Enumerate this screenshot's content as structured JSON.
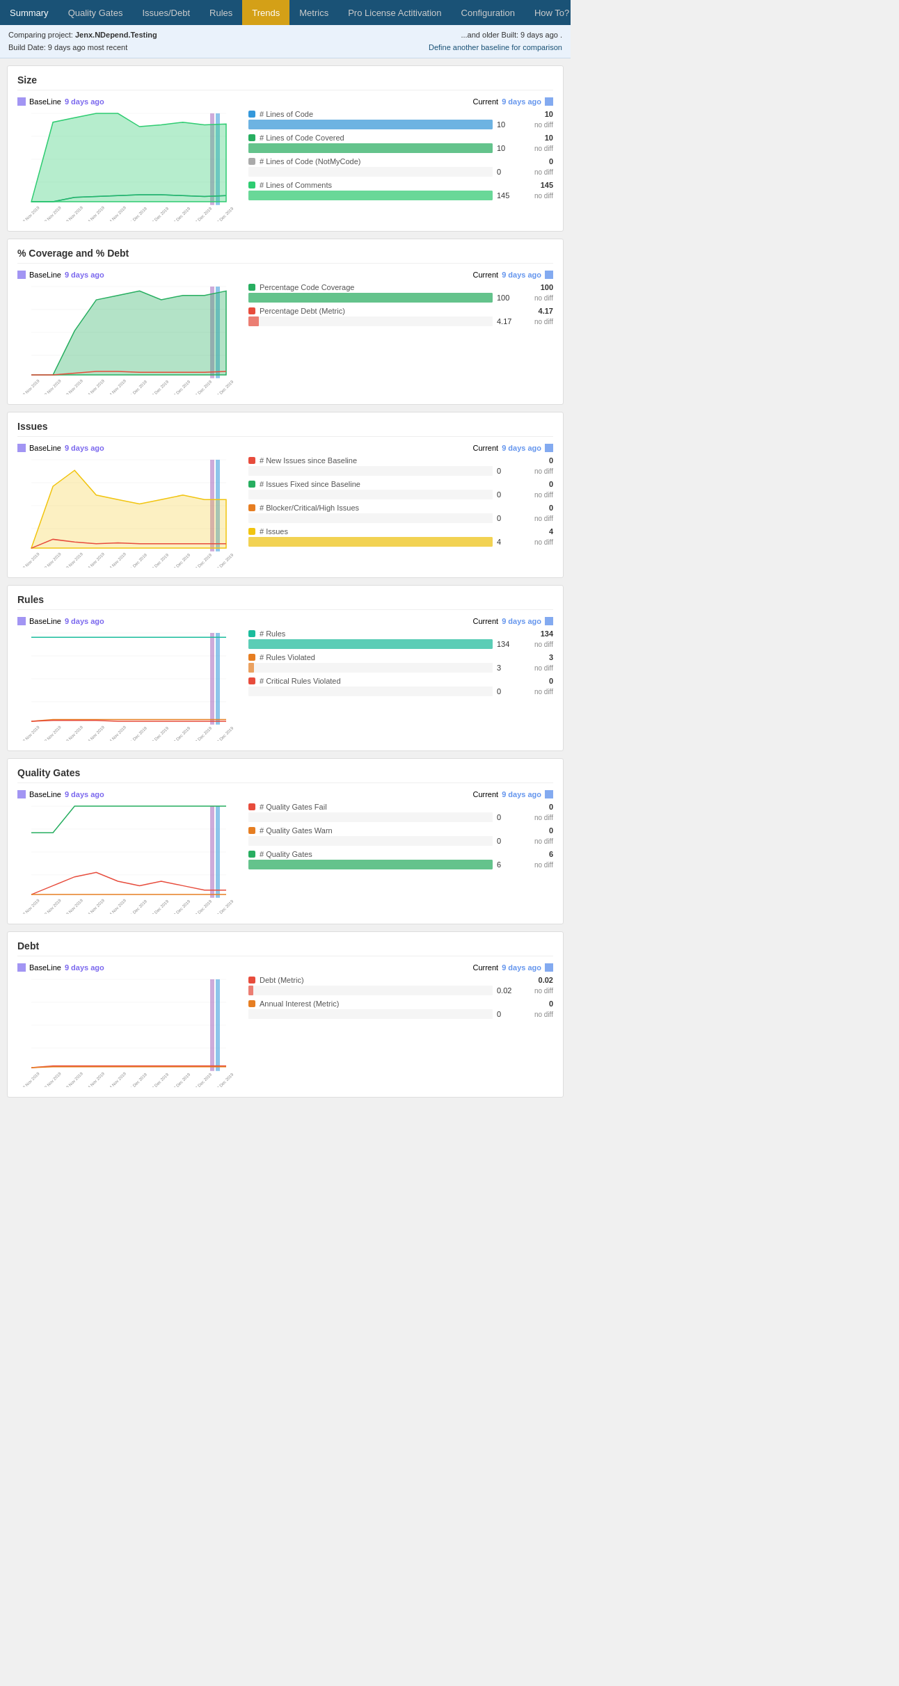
{
  "nav": {
    "items": [
      {
        "label": "Summary",
        "active": false
      },
      {
        "label": "Quality Gates",
        "active": false
      },
      {
        "label": "Issues/Debt",
        "active": false
      },
      {
        "label": "Rules",
        "active": false
      },
      {
        "label": "Trends",
        "active": true
      },
      {
        "label": "Metrics",
        "active": false
      },
      {
        "label": "Pro License Actitivation",
        "active": false
      },
      {
        "label": "Configuration",
        "active": false
      },
      {
        "label": "How To?",
        "active": false
      }
    ]
  },
  "infobar": {
    "project_label": "Comparing project:",
    "project_name": "Jenx.NDepend.Testing",
    "build_label": "Build Date: 9 days ago most recent",
    "older_label": "...and older Built: 9 days ago .",
    "define_link": "Define another baseline for comparison"
  },
  "baseline": {
    "label": "BaseLine",
    "date": "9 days ago"
  },
  "current": {
    "label": "Current",
    "date": "9 days ago"
  },
  "sections": [
    {
      "id": "size",
      "title": "Size",
      "metrics": [
        {
          "label": "# Lines of Code",
          "color": "#3498db",
          "value": 10,
          "max": 10,
          "nodiff": "no diff"
        },
        {
          "label": "# Lines of Code Covered",
          "color": "#27ae60",
          "value": 10,
          "max": 10,
          "nodiff": "no diff"
        },
        {
          "label": "# Lines of Code (NotMyCode)",
          "color": "#aaa",
          "value": 0,
          "max": 10,
          "nodiff": "no diff"
        },
        {
          "label": "# Lines of Comments",
          "color": "#2ecc71",
          "value": 145,
          "max": 145,
          "nodiff": "no diff"
        }
      ]
    },
    {
      "id": "coverage",
      "title": "% Coverage and % Debt",
      "metrics": [
        {
          "label": "Percentage Code Coverage",
          "color": "#27ae60",
          "value": 100,
          "max": 100,
          "nodiff": "no diff"
        },
        {
          "label": "Percentage Debt (Metric)",
          "color": "#e74c3c",
          "value": 4.17,
          "max": 100,
          "nodiff": "no diff"
        }
      ]
    },
    {
      "id": "issues",
      "title": "Issues",
      "metrics": [
        {
          "label": "# New Issues since Baseline",
          "color": "#e74c3c",
          "value": 0,
          "max": 10,
          "nodiff": "no diff"
        },
        {
          "label": "# Issues Fixed since Baseline",
          "color": "#27ae60",
          "value": 0,
          "max": 10,
          "nodiff": "no diff"
        },
        {
          "label": "# Blocker/Critical/High Issues",
          "color": "#e67e22",
          "value": 0,
          "max": 10,
          "nodiff": "no diff"
        },
        {
          "label": "# Issues",
          "color": "#f1c40f",
          "value": 4,
          "max": 4,
          "nodiff": "no diff"
        }
      ]
    },
    {
      "id": "rules",
      "title": "Rules",
      "metrics": [
        {
          "label": "# Rules",
          "color": "#1abc9c",
          "value": 134,
          "max": 134,
          "nodiff": "no diff"
        },
        {
          "label": "# Rules Violated",
          "color": "#e67e22",
          "value": 3,
          "max": 134,
          "nodiff": "no diff"
        },
        {
          "label": "# Critical Rules Violated",
          "color": "#e74c3c",
          "value": 0,
          "max": 134,
          "nodiff": "no diff"
        }
      ]
    },
    {
      "id": "qualitygates",
      "title": "Quality Gates",
      "metrics": [
        {
          "label": "# Quality Gates Fail",
          "color": "#e74c3c",
          "value": 0,
          "max": 6,
          "nodiff": "no diff"
        },
        {
          "label": "# Quality Gates Warn",
          "color": "#e67e22",
          "value": 0,
          "max": 6,
          "nodiff": "no diff"
        },
        {
          "label": "# Quality Gates",
          "color": "#27ae60",
          "value": 6,
          "max": 6,
          "nodiff": "no diff"
        }
      ]
    },
    {
      "id": "debt",
      "title": "Debt",
      "metrics": [
        {
          "label": "Debt (Metric)",
          "color": "#e74c3c",
          "value": 0.02,
          "max": 1,
          "nodiff": "no diff"
        },
        {
          "label": "Annual Interest (Metric)",
          "color": "#e67e22",
          "value": 0.0,
          "max": 1,
          "nodiff": "no diff"
        }
      ]
    }
  ]
}
